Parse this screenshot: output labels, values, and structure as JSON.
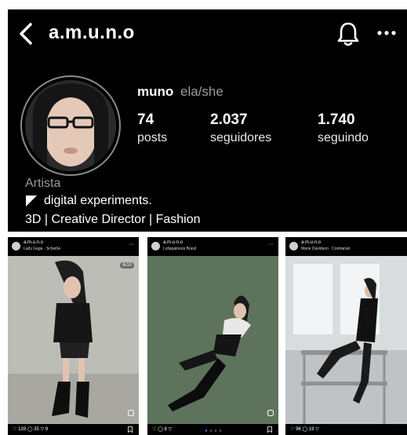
{
  "header": {
    "handle": "a.m.u.n.o"
  },
  "profile": {
    "display_name": "muno",
    "pronouns": "ela/she",
    "stats": [
      {
        "value": "74",
        "label": "posts"
      },
      {
        "value": "2.037",
        "label": "seguidores"
      },
      {
        "value": "1.740",
        "label": "seguindo"
      }
    ],
    "category": "Artista",
    "bio_line1": "digital experiments.",
    "bio_line2": "3D | Creative Director | Fashion"
  },
  "posts": [
    {
      "username": "a.m.u.n.o",
      "audio": "Lady Gaga · Scheiße",
      "badge": "6/10",
      "likes": "139",
      "comments": "35",
      "shares": "9"
    },
    {
      "username": "a.m.u.n.o",
      "audio": "Lollapalooza Brasil",
      "likes": "",
      "comments": "8",
      "shares": ""
    },
    {
      "username": "a.m.u.n.o",
      "audio": "Marie Davidson · Contrarian",
      "likes": "96",
      "comments": "19",
      "shares": ""
    }
  ],
  "colors": {
    "background": "#000000",
    "secondary_text": "#9a9a9a",
    "avatar_ring": "#8a8a8a"
  },
  "icons": [
    "back-arrow-icon",
    "bell-icon",
    "more-icon",
    "flag-icon",
    "heart-icon",
    "comment-icon",
    "share-icon",
    "bookmark-icon"
  ]
}
